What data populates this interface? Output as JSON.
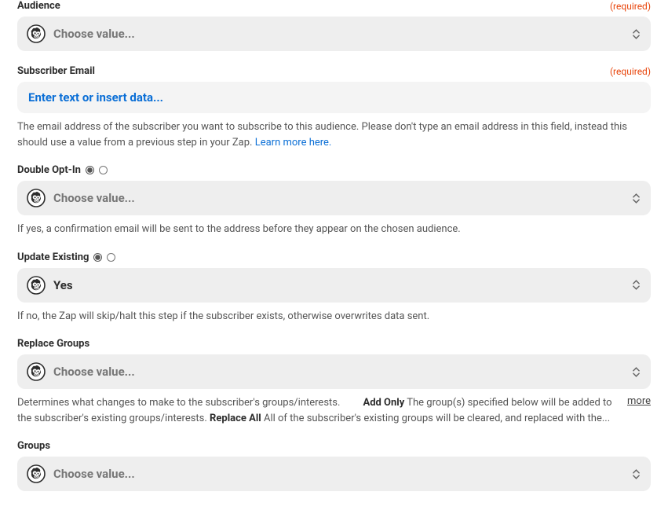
{
  "fields": {
    "audience": {
      "label": "Audience",
      "required_text": "(required)",
      "placeholder": "Choose value..."
    },
    "email": {
      "label": "Subscriber Email",
      "required_text": "(required)",
      "placeholder": "Enter text or insert data...",
      "help_a": "The email address of the subscriber you want to subscribe to this audience. Please don't type an email address in this field, instead this should use a value from a previous step in your Zap. ",
      "help_link": "Learn more here."
    },
    "double_opt": {
      "label": "Double Opt-In",
      "placeholder": "Choose value...",
      "help": "If yes, a confirmation email will be sent to the address before they appear on the chosen audience."
    },
    "update_existing": {
      "label": "Update Existing",
      "value": "Yes",
      "help": "If no, the Zap will skip/halt this step if the subscriber exists, otherwise overwrites data sent."
    },
    "replace_groups": {
      "label": "Replace Groups",
      "placeholder": "Choose value...",
      "help_pre": "Determines what changes to make to the subscriber's groups/interests. ",
      "bold1": "Add Only",
      "help_mid": " The group(s) specified below will be added to the subscriber's existing groups/interests. ",
      "bold2": "Replace All",
      "help_post": " All of the subscriber's existing groups will be cleared, and replaced with the...",
      "more": "more"
    },
    "groups": {
      "label": "Groups",
      "placeholder": "Choose value..."
    }
  }
}
